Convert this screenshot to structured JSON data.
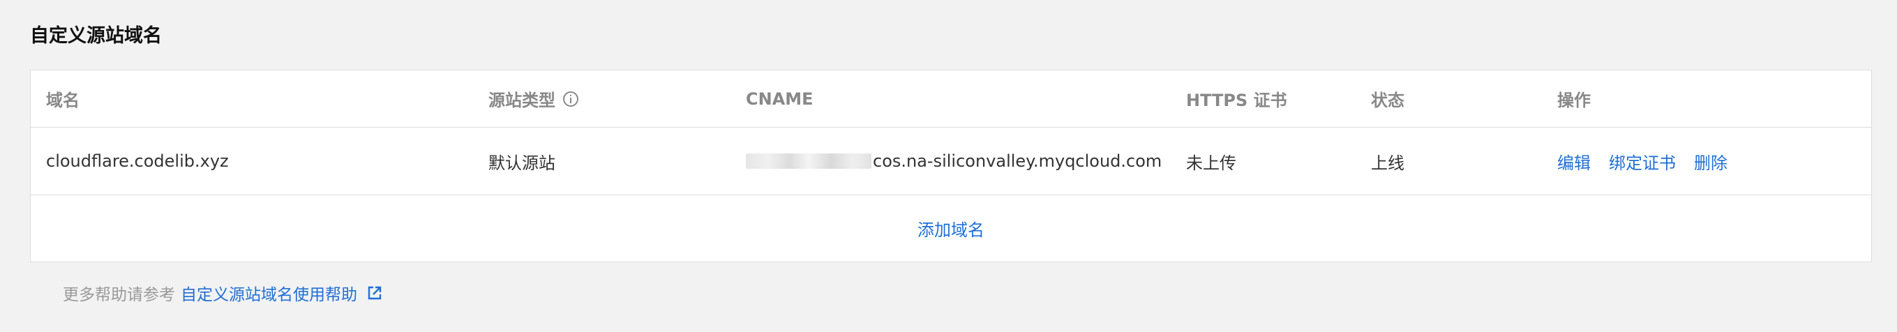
{
  "section": {
    "title": "自定义源站域名"
  },
  "table": {
    "headers": {
      "domain": "域名",
      "origin_type": "源站类型",
      "cname": "CNAME",
      "https": "HTTPS 证书",
      "status": "状态",
      "actions": "操作"
    },
    "rows": [
      {
        "domain": "cloudflare.codelib.xyz",
        "origin_type": "默认源站",
        "cname_suffix": "cos.na-siliconvalley.myqcloud.com",
        "https": "未上传",
        "status": "上线",
        "actions": {
          "edit": "编辑",
          "bind_cert": "绑定证书",
          "delete": "删除"
        }
      }
    ],
    "add_label": "添加域名"
  },
  "help": {
    "prefix": "更多帮助请参考",
    "link_label": "自定义源站域名使用帮助"
  },
  "colors": {
    "link": "#1f6fd6",
    "header_text": "#888888",
    "border": "#dcdcdc",
    "background": "#f2f2f2"
  },
  "icons": {
    "origin_type_info": "info-icon",
    "help_link": "external-link-icon"
  }
}
